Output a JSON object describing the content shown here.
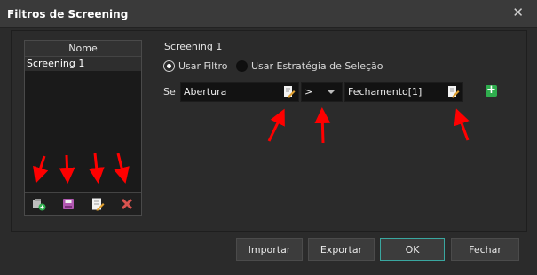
{
  "window": {
    "title": "Filtros de Screening"
  },
  "list": {
    "header": "Nome",
    "items": [
      {
        "label": "Screening 1"
      }
    ],
    "tools": [
      "new-screening-icon",
      "save-icon",
      "edit-icon",
      "delete-icon"
    ]
  },
  "editor": {
    "screening_name": "Screening 1",
    "radio_filter": "Usar Filtro",
    "radio_strategy": "Usar Estratégia de Seleção",
    "selected_mode": "Usar Filtro",
    "condition": {
      "prefix": "Se",
      "left": "Abertura",
      "operator": ">",
      "right": "Fechamento[1]"
    }
  },
  "buttons": {
    "import": "Importar",
    "export": "Exportar",
    "ok": "OK",
    "close": "Fechar"
  },
  "colors": {
    "accent": "#2fae4e",
    "annotation": "#ff0000",
    "ok_border": "#3aa7a0"
  }
}
